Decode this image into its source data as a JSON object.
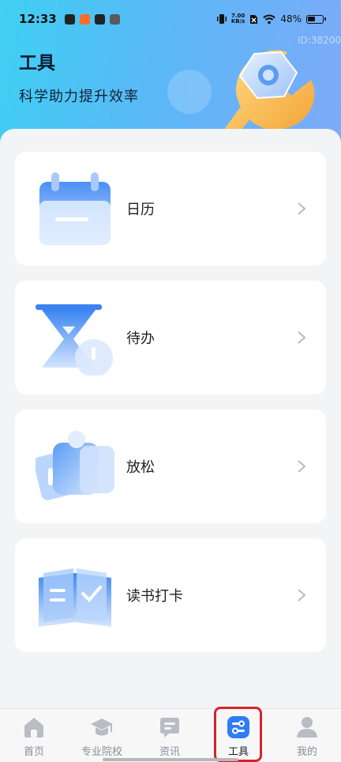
{
  "status_bar": {
    "time": "12:33",
    "net_speed_value": "7.00",
    "net_speed_unit": "KB/s",
    "battery": "48%"
  },
  "watermark": "ID:38200",
  "header": {
    "title": "工具",
    "subtitle": "科学助力提升效率"
  },
  "tools": [
    {
      "label": "日历",
      "icon": "calendar-icon"
    },
    {
      "label": "待办",
      "icon": "hourglass-icon"
    },
    {
      "label": "放松",
      "icon": "relax-icon"
    },
    {
      "label": "读书打卡",
      "icon": "book-icon"
    }
  ],
  "tabbar": {
    "items": [
      {
        "label": "首页",
        "icon": "home-icon",
        "active": false
      },
      {
        "label": "专业院校",
        "icon": "graduation-cap-icon",
        "active": false
      },
      {
        "label": "资讯",
        "icon": "message-icon",
        "active": false
      },
      {
        "label": "工具",
        "icon": "tools-icon",
        "active": true
      },
      {
        "label": "我的",
        "icon": "user-icon",
        "active": false
      }
    ]
  },
  "colors": {
    "accent": "#2f7cf6",
    "highlight_box": "#d8232a",
    "header_gradient_start": "#3fd0f2",
    "header_gradient_end": "#7eaaf9"
  }
}
